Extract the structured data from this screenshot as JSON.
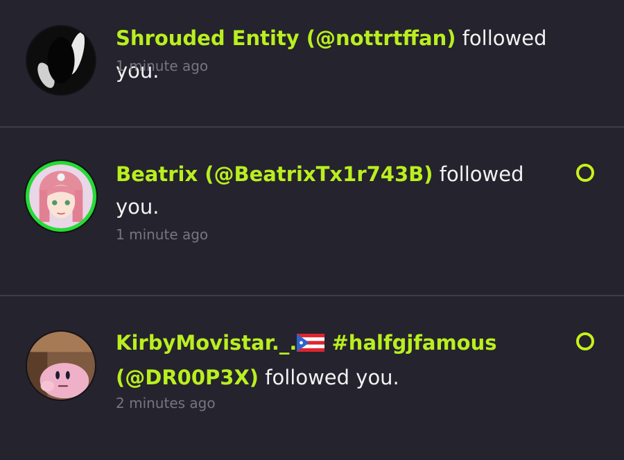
{
  "notifications": [
    {
      "name": "Shrouded Entity (@nottrtffan)",
      "action": " followed you.",
      "time": "1 minute ago",
      "avatar_icon": "shadowy-figure",
      "online": false,
      "unread": false
    },
    {
      "name": "Beatrix (@BeatrixTx1r743B)",
      "action": " followed you.",
      "time": "1 minute ago",
      "avatar_icon": "anime-girl",
      "online": true,
      "unread": true
    },
    {
      "name_part1": "KirbyMovistar._.",
      "flag_icon": "puerto-rico-flag",
      "name_part2": " #halfgjfamous (@DR00P3X)",
      "action": " followed you.",
      "time": "2 minutes ago",
      "avatar_icon": "kirby",
      "online": false,
      "unread": true
    }
  ],
  "colors": {
    "background": "#25232d",
    "name": "#b9ef1f",
    "text": "#f2f2f2",
    "time": "#77757f",
    "unread_dot": "#c7f21a",
    "online_ring": "#22dd33"
  }
}
